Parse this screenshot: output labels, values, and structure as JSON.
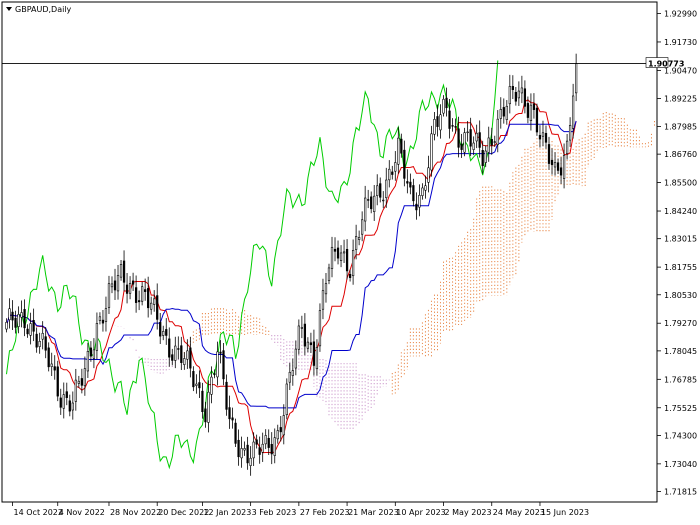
{
  "chart_data": {
    "type": "candlestick",
    "symbol_label": "GBPAUD,Daily",
    "current_price": 1.90773,
    "current_price_label": "1.90773",
    "ylim": [
      1.7135,
      1.935
    ],
    "y_ticks": [
      "1.92990",
      "1.91730",
      "1.90470",
      "1.89225",
      "1.87985",
      "1.86760",
      "1.85500",
      "1.84240",
      "1.83015",
      "1.81755",
      "1.80530",
      "1.79270",
      "1.78045",
      "1.76785",
      "1.75525",
      "1.74300",
      "1.73040",
      "1.71815"
    ],
    "x_ticks": [
      "14 Oct 2022",
      "4 Nov 2022",
      "28 Nov 2022",
      "20 Dec 2022",
      "12 Jan 2023",
      "3 Feb 2023",
      "27 Feb 2023",
      "21 Mar 2023",
      "10 Apr 2023",
      "2 May 2023",
      "24 May 2023",
      "15 Jun 2023"
    ],
    "x_tick_bar_index": [
      2,
      17,
      34,
      50,
      65,
      81,
      97,
      113,
      129,
      145,
      161,
      177
    ],
    "n_bars": 190,
    "key_closes": [
      [
        0,
        1.79
      ],
      [
        6,
        1.797
      ],
      [
        10,
        1.786
      ],
      [
        14,
        1.775
      ],
      [
        18,
        1.762
      ],
      [
        22,
        1.758
      ],
      [
        26,
        1.769
      ],
      [
        30,
        1.793
      ],
      [
        34,
        1.805
      ],
      [
        38,
        1.812
      ],
      [
        42,
        1.81
      ],
      [
        46,
        1.804
      ],
      [
        50,
        1.793
      ],
      [
        54,
        1.784
      ],
      [
        58,
        1.778
      ],
      [
        62,
        1.767
      ],
      [
        66,
        1.756
      ],
      [
        70,
        1.78
      ],
      [
        74,
        1.748
      ],
      [
        78,
        1.738
      ],
      [
        82,
        1.734
      ],
      [
        86,
        1.737
      ],
      [
        90,
        1.745
      ],
      [
        94,
        1.767
      ],
      [
        98,
        1.79
      ],
      [
        102,
        1.78
      ],
      [
        106,
        1.812
      ],
      [
        110,
        1.825
      ],
      [
        114,
        1.82
      ],
      [
        118,
        1.838
      ],
      [
        122,
        1.848
      ],
      [
        126,
        1.857
      ],
      [
        130,
        1.868
      ],
      [
        134,
        1.848
      ],
      [
        138,
        1.852
      ],
      [
        142,
        1.878
      ],
      [
        146,
        1.888
      ],
      [
        150,
        1.876
      ],
      [
        154,
        1.872
      ],
      [
        158,
        1.867
      ],
      [
        162,
        1.88
      ],
      [
        166,
        1.888
      ],
      [
        170,
        1.896
      ],
      [
        174,
        1.89
      ],
      [
        178,
        1.87
      ],
      [
        182,
        1.86
      ],
      [
        186,
        1.872
      ],
      [
        189,
        1.908
      ]
    ],
    "series": [
      {
        "key": "tenkan",
        "color": "#dd0000"
      },
      {
        "key": "kijun",
        "color": "#0000cc"
      },
      {
        "key": "chikou",
        "color": "#00cc00"
      },
      {
        "key": "cloud_a",
        "color": "#e8884a"
      },
      {
        "key": "cloud_b",
        "color": "#cc99cc"
      }
    ],
    "candle_color": "#000000",
    "grid": false
  }
}
